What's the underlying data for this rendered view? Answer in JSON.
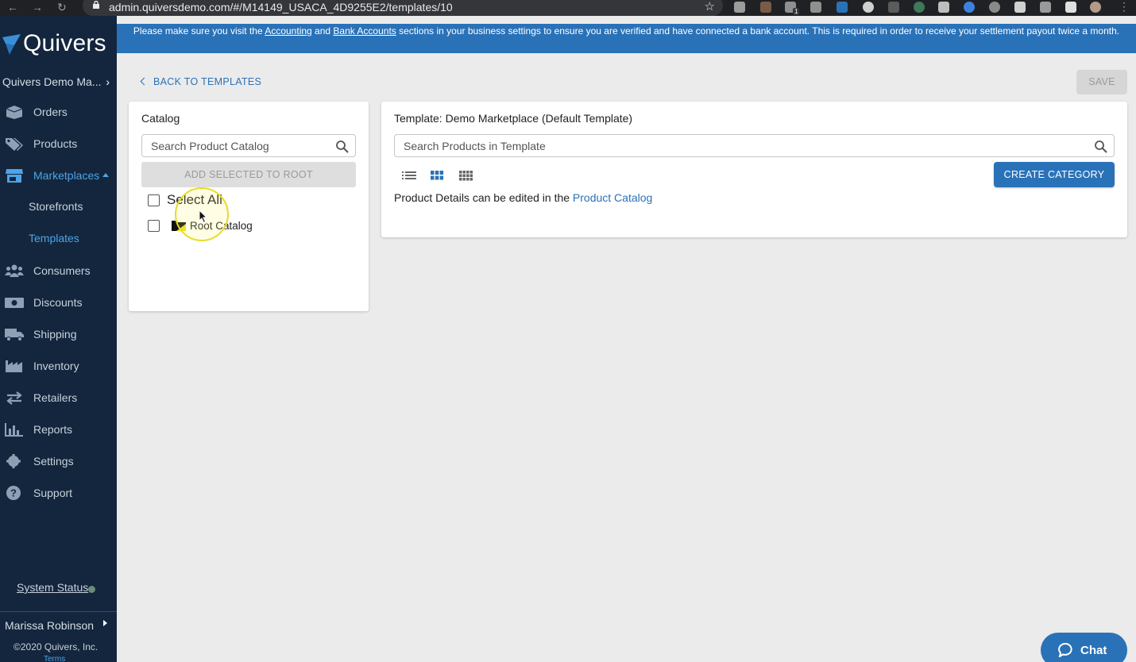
{
  "browser": {
    "url": "admin.quiversdemo.com/#/M14149_USACA_4D9255E2/templates/10",
    "extension_badge": "1"
  },
  "banner": {
    "text_before": "Please make sure you visit the ",
    "accounting_link": "Accounting",
    "text_and": " and ",
    "bank_link": "Bank Accounts",
    "text_after": " sections in your business settings to ensure you are verified and have connected a bank account. This is required in order to receive your settlement payout twice a month."
  },
  "sidebar": {
    "logo": "Quivers",
    "account": "Quivers Demo Ma...",
    "nav": [
      {
        "label": "Orders",
        "icon": "box-icon"
      },
      {
        "label": "Products",
        "icon": "tags-icon"
      },
      {
        "label": "Marketplaces",
        "icon": "store-icon"
      },
      {
        "label": "Consumers",
        "icon": "users-icon"
      },
      {
        "label": "Discounts",
        "icon": "money-icon"
      },
      {
        "label": "Shipping",
        "icon": "truck-icon"
      },
      {
        "label": "Inventory",
        "icon": "warehouse-icon"
      },
      {
        "label": "Retailers",
        "icon": "exchange-icon"
      },
      {
        "label": "Reports",
        "icon": "bar-chart-icon"
      },
      {
        "label": "Settings",
        "icon": "gear-icon"
      },
      {
        "label": "Support",
        "icon": "question-icon"
      }
    ],
    "sub_items": [
      "Storefronts",
      "Templates"
    ],
    "system_status": "System Status",
    "user": "Marissa Robinson",
    "copyright": "©2020 Quivers, Inc.",
    "terms": "Terms",
    "colors": {
      "background": "#13263d",
      "active": "#4ea3e8"
    }
  },
  "main": {
    "back_link": "BACK TO TEMPLATES",
    "save": "SAVE",
    "catalog": {
      "title": "Catalog",
      "search_placeholder": "Search Product Catalog",
      "add_button": "ADD SELECTED TO ROOT",
      "select_all": "Select All",
      "root_item": "Root Catalog"
    },
    "template": {
      "title": "Template: Demo Marketplace (Default Template)",
      "search_placeholder": "Search Products in Template",
      "create_category": "CREATE CATEGORY",
      "note_prefix": "Product Details can be edited in the ",
      "note_link": "Product Catalog"
    },
    "chat": "Chat",
    "colors": {
      "primary": "#2a72b8",
      "background": "#ebebeb"
    }
  }
}
